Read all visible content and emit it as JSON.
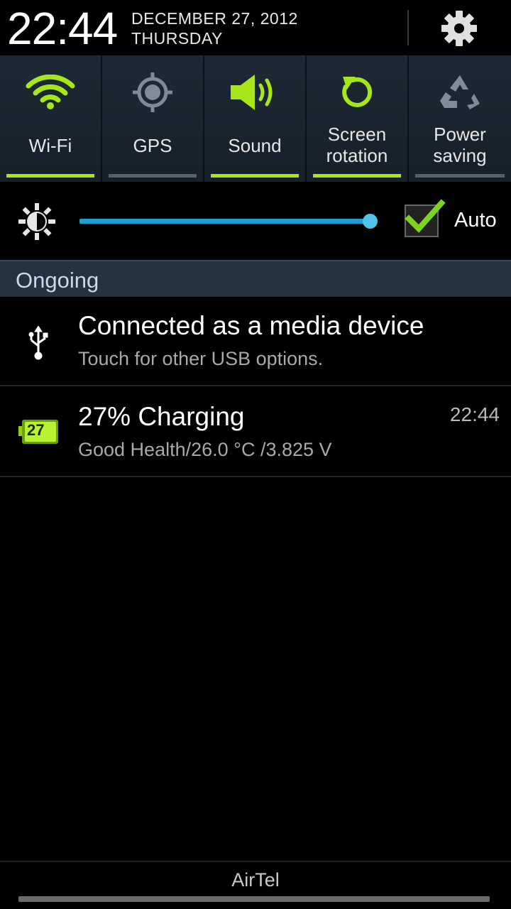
{
  "header": {
    "time": "22:44",
    "date": "DECEMBER 27, 2012",
    "day": "THURSDAY",
    "settings_icon": "gear-icon"
  },
  "toggles": [
    {
      "label": "Wi-Fi",
      "icon": "wifi-icon",
      "on": true
    },
    {
      "label": "GPS",
      "icon": "gps-icon",
      "on": false
    },
    {
      "label": "Sound",
      "icon": "sound-icon",
      "on": true
    },
    {
      "label_line1": "Screen",
      "label_line2": "rotation",
      "icon": "screen-rotation-icon",
      "on": true
    },
    {
      "label_line1": "Power",
      "label_line2": "saving",
      "icon": "power-saving-icon",
      "on": false
    }
  ],
  "brightness": {
    "level": 1.0,
    "auto_checked": true,
    "auto_label": "Auto"
  },
  "section": {
    "title": "Ongoing"
  },
  "notifications": [
    {
      "icon": "usb-icon",
      "title": "Connected as a media device",
      "subtitle": "Touch for other USB options."
    },
    {
      "icon": "battery-icon",
      "badge": "27",
      "title": "27% Charging",
      "subtitle": "Good Health/26.0 °C /3.825 V",
      "time": "22:44"
    }
  ],
  "footer": {
    "carrier": "AirTel"
  },
  "colors": {
    "accent_on": "#a8e61c",
    "slider": "#1e9fd2",
    "panel": "#1c2530"
  }
}
